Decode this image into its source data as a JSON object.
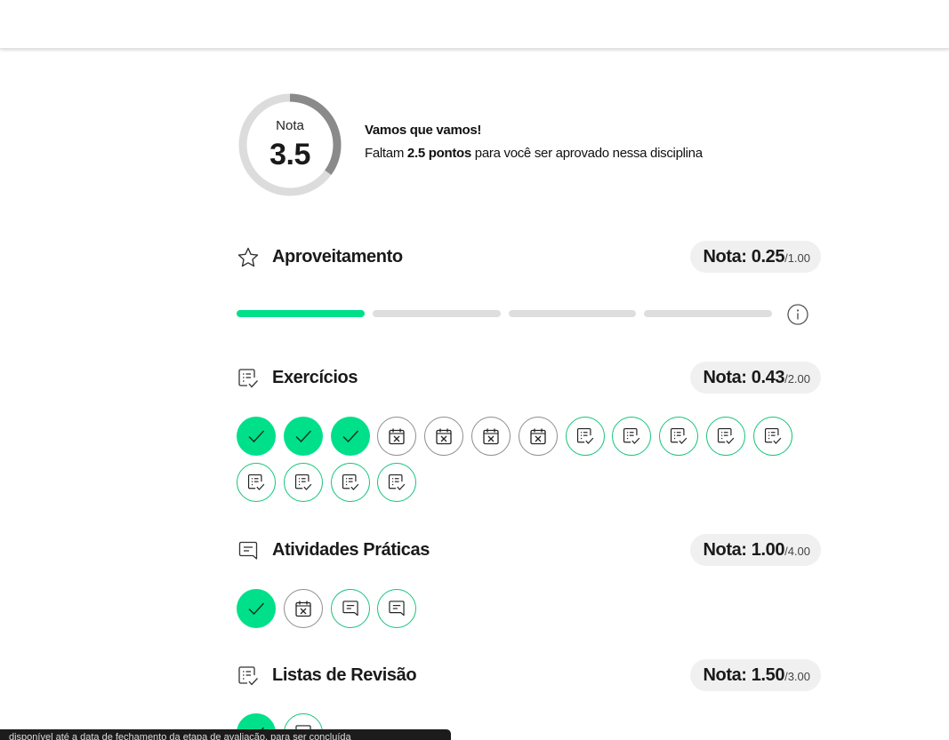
{
  "score": {
    "label": "Nota",
    "value": "3.5",
    "fraction": 0.35
  },
  "motivation": {
    "title": "Vamos que vamos!",
    "text_before": "Faltam ",
    "points": "2.5 pontos",
    "text_after": " para você ser aprovado nessa disciplina"
  },
  "sections": {
    "aproveitamento": {
      "title": "Aproveitamento",
      "nota_label": "Nota:",
      "nota": "0.25",
      "max": "/1.00",
      "progress": {
        "segments": 4,
        "filled": 1
      },
      "icon": "star-icon"
    },
    "exercicios": {
      "title": "Exercícios",
      "nota_label": "Nota:",
      "nota": "0.43",
      "max": "/2.00",
      "icon": "checklist-icon",
      "items": [
        "done",
        "done",
        "done",
        "missed",
        "missed",
        "missed",
        "missed",
        "pending",
        "pending",
        "pending",
        "pending",
        "pending",
        "pending",
        "pending",
        "pending",
        "pending"
      ]
    },
    "atividades": {
      "title": "Atividades Práticas",
      "nota_label": "Nota:",
      "nota": "1.00",
      "max": "/4.00",
      "icon": "chat-icon",
      "items": [
        "done",
        "missed",
        "pending",
        "pending"
      ]
    },
    "listas": {
      "title": "Listas de Revisão",
      "nota_label": "Nota:",
      "nota": "1.50",
      "max": "/3.00",
      "icon": "checklist-icon",
      "items": [
        "done",
        "pending"
      ]
    }
  },
  "toast": {
    "text": "disponível até a data de fechamento da etapa de avaliação, para ser concluída"
  },
  "colors": {
    "accent": "#00e08a",
    "pending_border": "#14c47a",
    "missed_border": "#8d8d8d",
    "track": "#dedede",
    "pill_bg": "#f0f0f0"
  }
}
